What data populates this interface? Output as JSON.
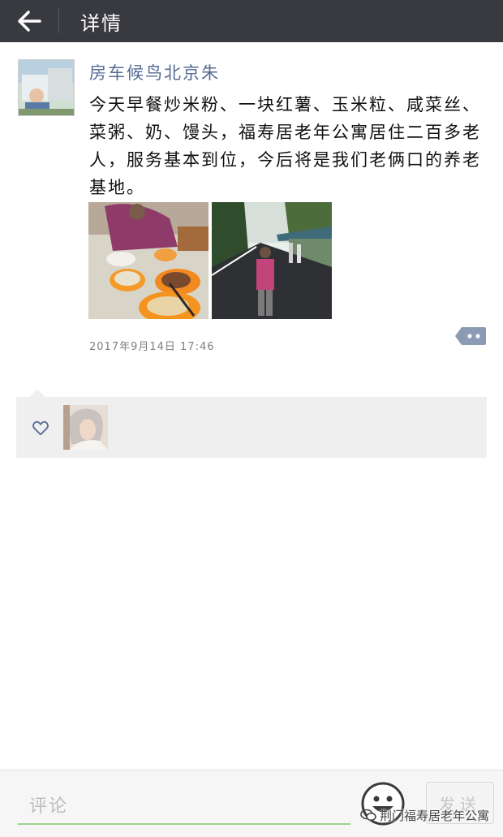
{
  "header": {
    "title": "详情"
  },
  "post": {
    "author": "房车候鸟北京朱",
    "text": "今天早餐炒米粉、一块红薯、玉米粒、咸菜丝、菜粥、奶、馒头，福寿居老年公寓居住二百多老人，服务基本到位，今后将是我们老俩口的养老基地。",
    "timestamp": "2017年9月14日 17:46",
    "photos": [
      "breakfast-photo",
      "street-photo"
    ]
  },
  "likes": {
    "icon": "heart-icon",
    "count": 1
  },
  "comment_bar": {
    "placeholder": "评论",
    "send_label": "发送"
  },
  "watermark": {
    "text": "荆门福寿居老年公寓"
  },
  "colors": {
    "topbar": "#393a3f",
    "author_name": "#576b95",
    "likes_bg": "#efefef",
    "input_underline": "#9bd38c",
    "comment_icon": "#8a9bb3"
  }
}
